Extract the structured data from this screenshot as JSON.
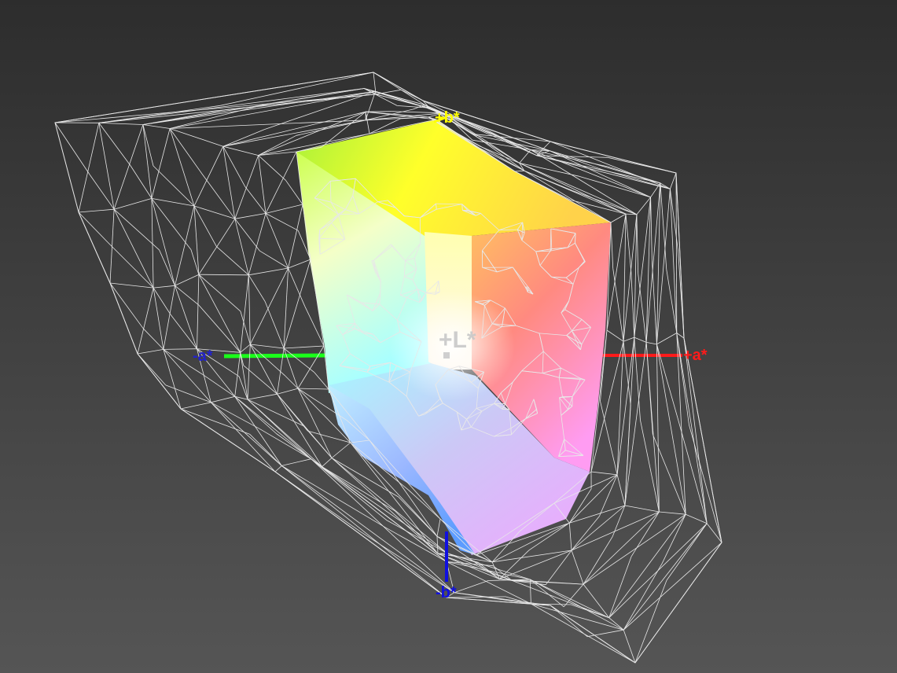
{
  "axes": {
    "plus_b_label": "+b*",
    "minus_b_label": "-b*",
    "plus_a_label": "+a*",
    "minus_a_label": "-a*",
    "plus_l_label": "+L*"
  },
  "colors": {
    "plus_b_axis": "#ffff00",
    "minus_b_axis": "#1010e0",
    "plus_a_axis": "#ff1a1a",
    "minus_a_axis": "#1aff1a",
    "minus_a_label": "#2222cc",
    "plus_l_label": "#c8c8c8",
    "wireframe": "#e8e8e8"
  }
}
